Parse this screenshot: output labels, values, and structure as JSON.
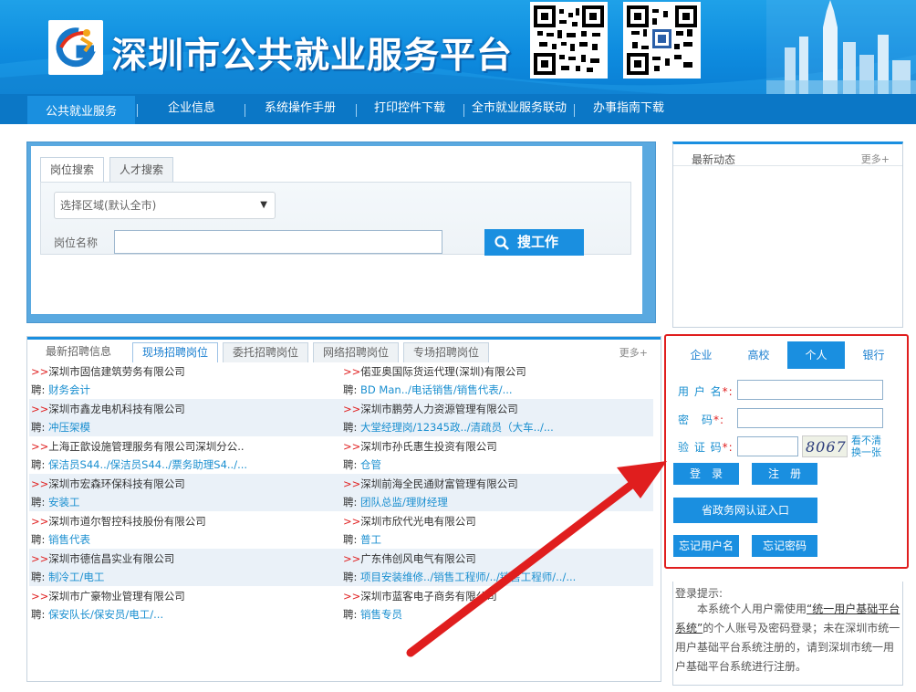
{
  "header": {
    "site_title": "深圳市公共就业服务平台"
  },
  "nav": {
    "items": [
      {
        "label": "公共就业服务",
        "active": true
      },
      {
        "label": "企业信息"
      },
      {
        "label": "系统操作手册"
      },
      {
        "label": "打印控件下载"
      },
      {
        "label": "全市就业服务联动"
      },
      {
        "label": "办事指南下载"
      }
    ]
  },
  "search": {
    "tabs": [
      "岗位搜索",
      "人才搜索"
    ],
    "area_select": "选择区域(默认全市)",
    "keyword_label": "岗位名称",
    "keyword_value": "",
    "button_label": "搜工作"
  },
  "news": {
    "title": "最新动态",
    "more": "更多+"
  },
  "jobs": {
    "tabs": [
      "最新招聘信息",
      "现场招聘岗位",
      "委托招聘岗位",
      "网络招聘岗位",
      "专场招聘岗位"
    ],
    "more": "更多+",
    "marker": ">>",
    "post_label": "聘:",
    "left": [
      {
        "company": "深圳市固信建筑劳务有限公司",
        "positions": "财务会计"
      },
      {
        "company": "深圳市鑫龙电机科技有限公司",
        "positions": "冲压架模"
      },
      {
        "company": "上海正歆设施管理服务有限公司深圳分公..",
        "positions": "保洁员S44../保洁员S44../票务助理S4../..."
      },
      {
        "company": "深圳市宏森环保科技有限公司",
        "positions": "安装工"
      },
      {
        "company": "深圳市道尔智控科技股份有限公司",
        "positions": "销售代表"
      },
      {
        "company": "深圳市德信昌实业有限公司",
        "positions": "制冷工/电工"
      },
      {
        "company": "深圳市广豪物业管理有限公司",
        "positions": "保安队长/保安员/电工/..."
      }
    ],
    "right": [
      {
        "company": "偌亚奥国际货运代理(深圳)有限公司",
        "positions": "BD Man../电话销售/销售代表/..."
      },
      {
        "company": "深圳市鹏劳人力资源管理有限公司",
        "positions": "大堂经理岗/12345政../清疏员（大车../..."
      },
      {
        "company": "深圳市孙氏惠生投资有限公司",
        "positions": "仓管"
      },
      {
        "company": "深圳前海全民通财富管理有限公司",
        "positions": "团队总监/理财经理"
      },
      {
        "company": "深圳市欣代光电有限公司",
        "positions": "普工"
      },
      {
        "company": "广东伟创风电气有限公司",
        "positions": "项目安装维修../销售工程师/../销售工程师/../..."
      },
      {
        "company": "深圳市蓝客电子商务有限公司",
        "positions": "销售专员"
      }
    ]
  },
  "login": {
    "tabs": [
      "企业",
      "高校",
      "个人",
      "银行"
    ],
    "active_tab": "个人",
    "username_label": "用 户 名",
    "password_label": "密　码",
    "captcha_label": "验 证 码",
    "required_mark": "*:",
    "captcha_text": "8067",
    "captcha_refresh_1": "看不清",
    "captcha_refresh_2": "换一张",
    "login_button": "登　录",
    "register_button": "注　册",
    "gov_login_button": "省政务网认证入口",
    "forgot_username": "忘记用户名",
    "forgot_password": "忘记密码"
  },
  "tips": {
    "title": "登录提示:",
    "text_1": "本系统个人用户需使用",
    "link": "“统一用户基础平台系统”",
    "text_2": "的个人账号及密码登录；未在深圳市统一用户基础平台系统注册的，请到深圳市统一用户基础平台系统进行注册。"
  },
  "colors": {
    "primary": "#1a8fe0",
    "nav": "#0b77c6",
    "annotation": "#e01e1e"
  }
}
